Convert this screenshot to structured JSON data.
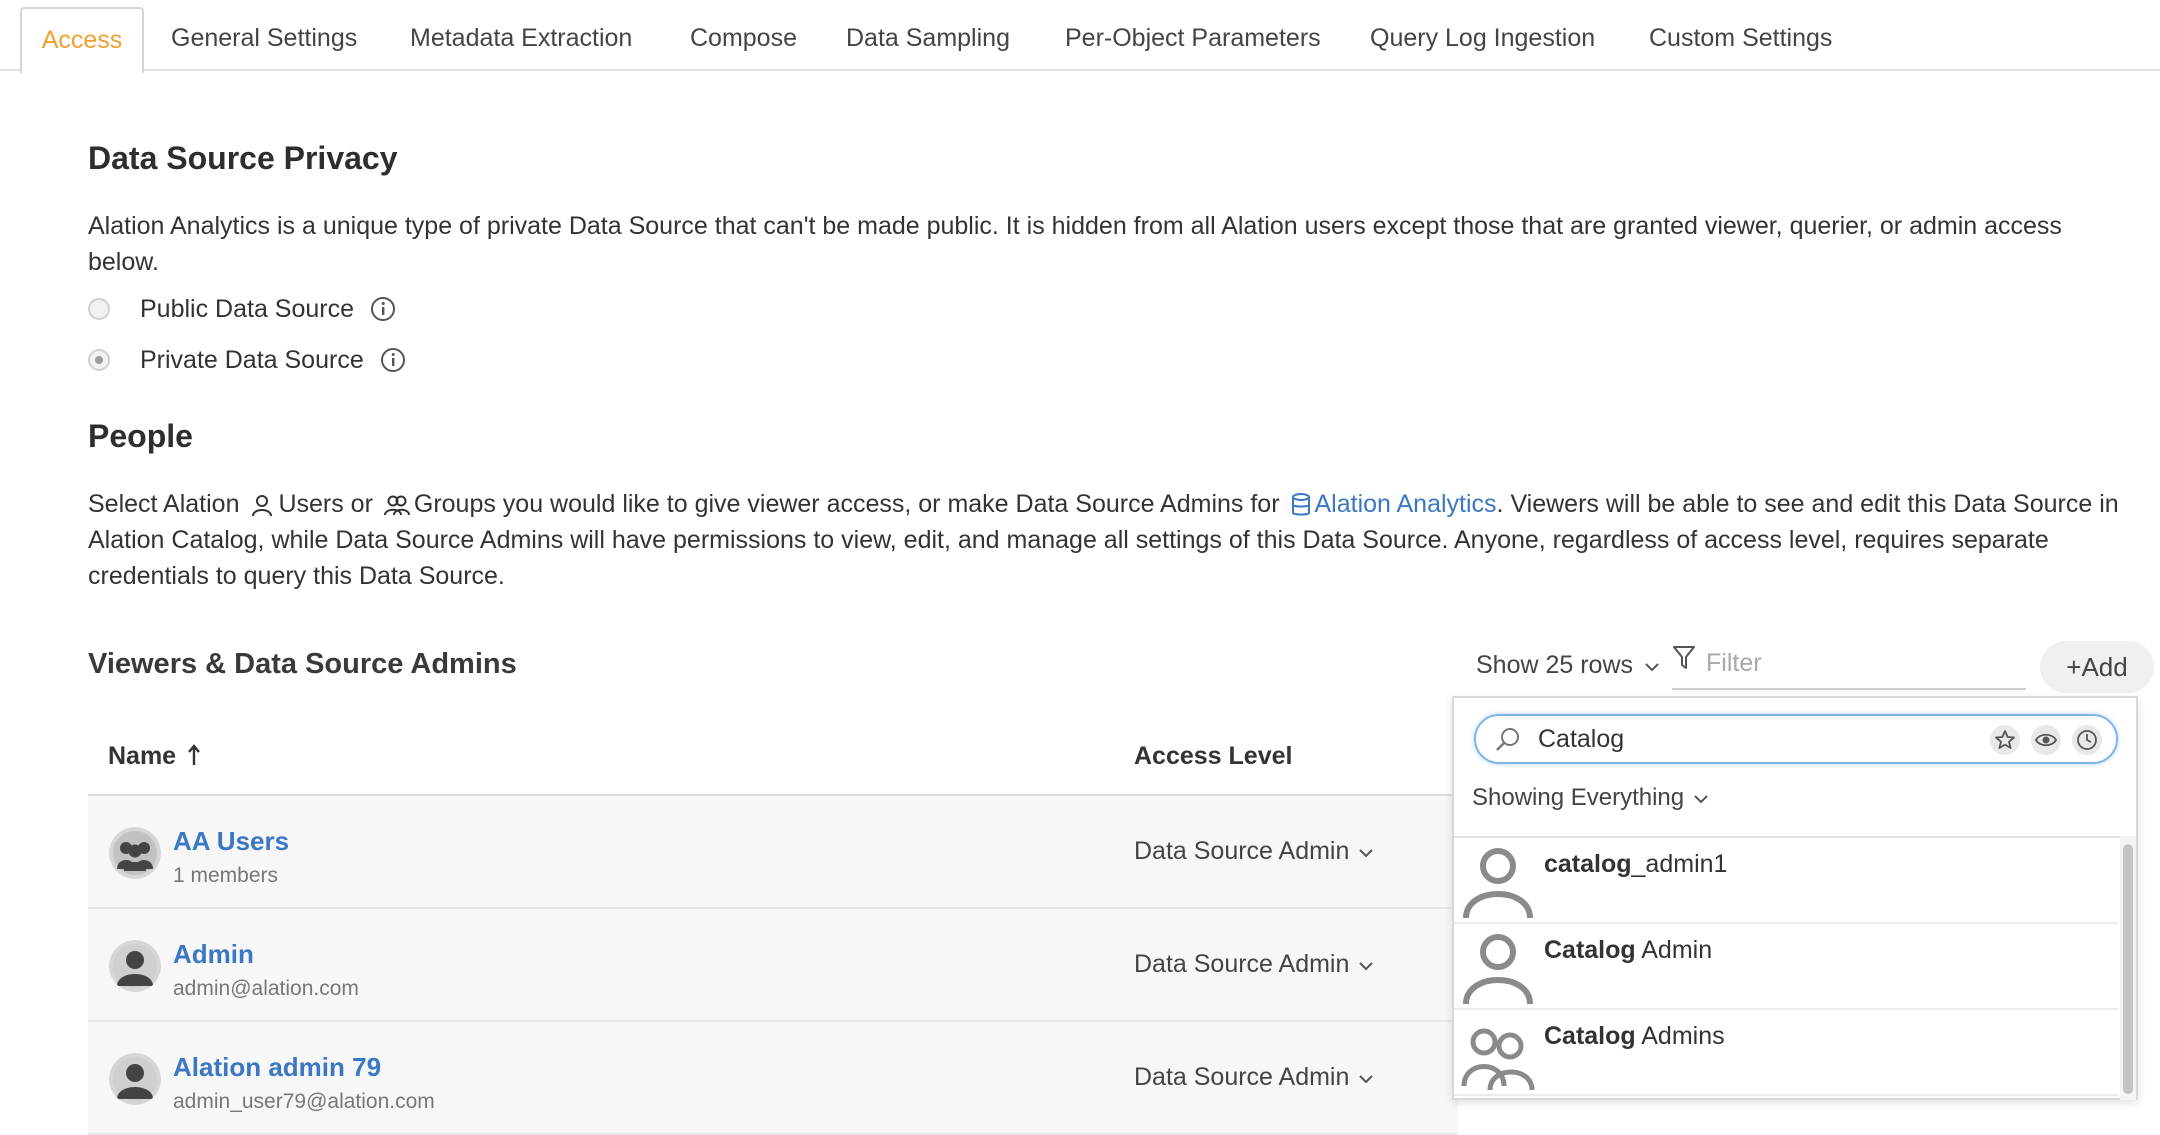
{
  "tabs": [
    "Access",
    "General Settings",
    "Metadata Extraction",
    "Compose",
    "Data Sampling",
    "Per-Object Parameters",
    "Query Log Ingestion",
    "Custom Settings"
  ],
  "privacy": {
    "heading": "Data Source Privacy",
    "description": "Alation Analytics is a unique type of private Data Source that can't be made public. It is hidden from all Alation users except those that are granted viewer, querier, or admin access below.",
    "options": [
      {
        "label": "Public Data Source",
        "checked": false
      },
      {
        "label": "Private Data Source",
        "checked": true
      }
    ]
  },
  "people": {
    "heading": "People",
    "desc_1": "Select Alation",
    "desc_users": "Users or",
    "desc_groups": "Groups you would like to give viewer access, or make Data Source Admins for",
    "desc_link": "Alation Analytics",
    "desc_2": ". Viewers will be able to see and edit this Data Source in Alation Catalog, while Data Source Admins will have permissions to view, edit, and manage all settings of this Data Source. Anyone, regardless of access level, requires separate credentials to query this Data Source."
  },
  "table": {
    "title": "Viewers & Data Source Admins",
    "show_rows": "Show 25 rows",
    "filter_placeholder": "Filter",
    "add_label": "+Add",
    "columns": {
      "name": "Name",
      "access": "Access Level"
    },
    "rows": [
      {
        "name": "AA Users",
        "sub": "1 members",
        "access": "Data Source Admin",
        "type": "group"
      },
      {
        "name": "Admin",
        "sub": "admin@alation.com",
        "access": "Data Source Admin",
        "type": "user"
      },
      {
        "name": "Alation admin 79",
        "sub": "admin_user79@alation.com",
        "access": "Data Source Admin",
        "type": "user"
      }
    ]
  },
  "dropdown": {
    "search_value": "Catalog",
    "showing": "Showing Everything",
    "items": [
      {
        "bold": "catalog",
        "rest": "_admin1",
        "type": "user"
      },
      {
        "bold": "Catalog",
        "rest": " Admin",
        "type": "user"
      },
      {
        "bold": "Catalog",
        "rest": " Admins",
        "type": "group"
      }
    ]
  },
  "colors": {
    "accent": "#f0a030",
    "link": "#3b78c3",
    "focus": "#7fb4e8"
  }
}
